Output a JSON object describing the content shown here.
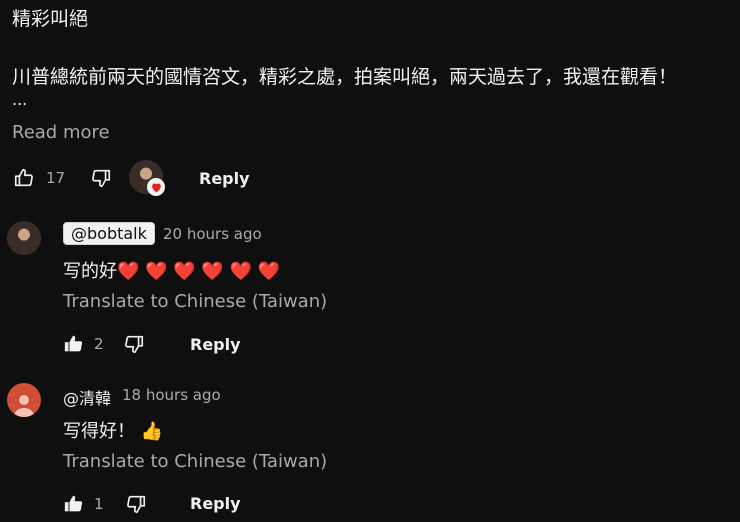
{
  "comment": {
    "title": "精彩叫絕",
    "body": "川普總統前兩天的國情咨文，精彩之處，拍案叫絕，兩天過去了，我還在觀看！",
    "ellipsis": "...",
    "read_more": "Read more",
    "like_count": "17",
    "reply_label": "Reply"
  },
  "replies": [
    {
      "handle": "@bobtalk",
      "time": "20 hours ago",
      "text": "写的好❤️ ❤️ ❤️ ❤️ ❤️ ❤️",
      "translate": "Translate to Chinese (Taiwan)",
      "like_count": "2",
      "reply_label": "Reply"
    },
    {
      "handle": "@清韓",
      "time": "18 hours ago",
      "text": "写得好！ 👍",
      "translate": "Translate to Chinese (Taiwan)",
      "like_count": "1",
      "reply_label": "Reply"
    }
  ],
  "colors": {
    "background": "#0f0f0f",
    "text": "#f1f1f1",
    "muted": "#aaaaaa",
    "heart": "#e62117",
    "default_avatar": "#d04e35"
  },
  "icons": [
    "thumbs-up-icon",
    "thumbs-down-icon",
    "heart-icon",
    "person-icon"
  ]
}
